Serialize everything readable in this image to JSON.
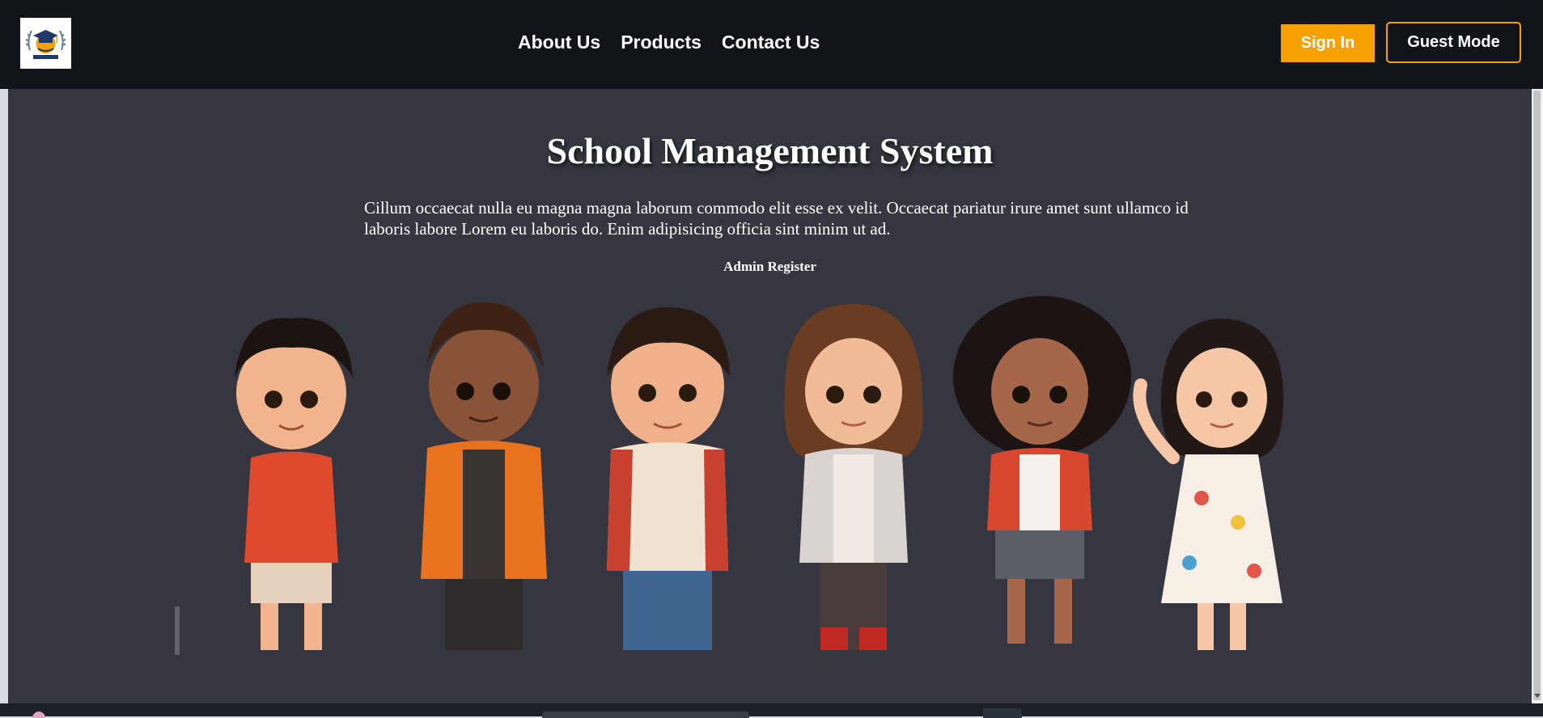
{
  "nav": {
    "logo_icon": "graduation-cap-logo-icon",
    "links": [
      "About Us",
      "Products",
      "Contact Us"
    ],
    "sign_in_label": "Sign In",
    "guest_mode_label": "Guest Mode"
  },
  "hero": {
    "title": "School Management System",
    "description": "Cillum occaecat nulla eu magna magna laborum commodo elit esse ex velit. Occaecat pariatur irure amet sunt ullamco id laboris labore Lorem eu laboris do. Enim adipisicing officia sint minim ut ad.",
    "admin_register_label": "Admin Register"
  },
  "colors": {
    "navbar_bg": "#111418",
    "main_bg": "#363640",
    "accent": "#f7a100"
  }
}
